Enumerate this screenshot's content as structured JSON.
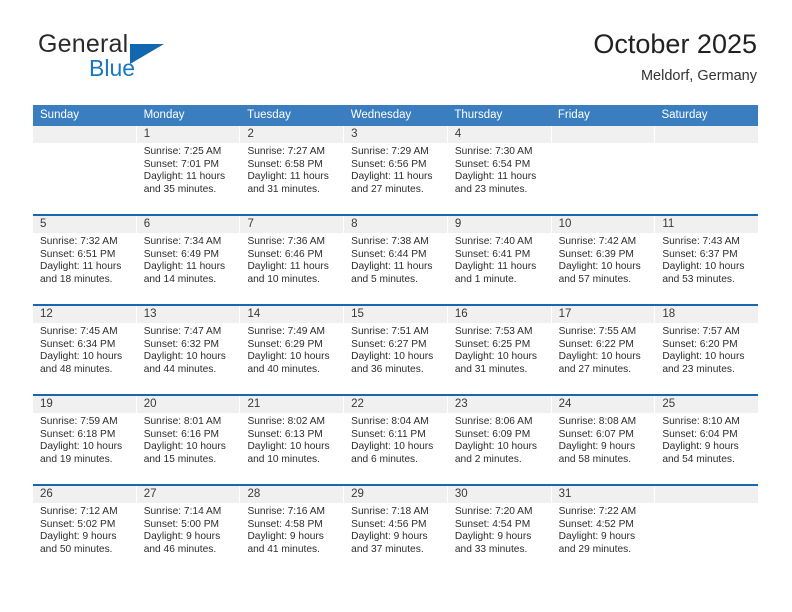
{
  "brand": {
    "word_general": "General",
    "word_blue": "Blue",
    "triangle_color": "#1167b0",
    "blue_color": "#1878c6"
  },
  "header": {
    "title": "October 2025",
    "location": "Meldorf, Germany"
  },
  "theme": {
    "header_bar": "#3a7ec0",
    "row_divider": "#1a67ad",
    "day_number_bg": "#f0f0f0"
  },
  "weekdays": [
    {
      "label": "Sunday"
    },
    {
      "label": "Monday"
    },
    {
      "label": "Tuesday"
    },
    {
      "label": "Wednesday"
    },
    {
      "label": "Thursday"
    },
    {
      "label": "Friday"
    },
    {
      "label": "Saturday"
    }
  ],
  "weeks": [
    {
      "days": [
        {
          "number": "",
          "sunrise": "",
          "sunset": "",
          "daylight": "",
          "empty": true
        },
        {
          "number": "1",
          "sunrise": "Sunrise: 7:25 AM",
          "sunset": "Sunset: 7:01 PM",
          "daylight": "Daylight: 11 hours and 35 minutes."
        },
        {
          "number": "2",
          "sunrise": "Sunrise: 7:27 AM",
          "sunset": "Sunset: 6:58 PM",
          "daylight": "Daylight: 11 hours and 31 minutes."
        },
        {
          "number": "3",
          "sunrise": "Sunrise: 7:29 AM",
          "sunset": "Sunset: 6:56 PM",
          "daylight": "Daylight: 11 hours and 27 minutes."
        },
        {
          "number": "4",
          "sunrise": "Sunrise: 7:30 AM",
          "sunset": "Sunset: 6:54 PM",
          "daylight": "Daylight: 11 hours and 23 minutes."
        },
        {
          "number": "",
          "sunrise": "",
          "sunset": "",
          "daylight": "",
          "empty": true
        },
        {
          "number": "",
          "sunrise": "",
          "sunset": "",
          "daylight": "",
          "empty": true
        }
      ]
    },
    {
      "days": [
        {
          "number": "5",
          "sunrise": "Sunrise: 7:32 AM",
          "sunset": "Sunset: 6:51 PM",
          "daylight": "Daylight: 11 hours and 18 minutes."
        },
        {
          "number": "6",
          "sunrise": "Sunrise: 7:34 AM",
          "sunset": "Sunset: 6:49 PM",
          "daylight": "Daylight: 11 hours and 14 minutes."
        },
        {
          "number": "7",
          "sunrise": "Sunrise: 7:36 AM",
          "sunset": "Sunset: 6:46 PM",
          "daylight": "Daylight: 11 hours and 10 minutes."
        },
        {
          "number": "8",
          "sunrise": "Sunrise: 7:38 AM",
          "sunset": "Sunset: 6:44 PM",
          "daylight": "Daylight: 11 hours and 5 minutes."
        },
        {
          "number": "9",
          "sunrise": "Sunrise: 7:40 AM",
          "sunset": "Sunset: 6:41 PM",
          "daylight": "Daylight: 11 hours and 1 minute."
        },
        {
          "number": "10",
          "sunrise": "Sunrise: 7:42 AM",
          "sunset": "Sunset: 6:39 PM",
          "daylight": "Daylight: 10 hours and 57 minutes."
        },
        {
          "number": "11",
          "sunrise": "Sunrise: 7:43 AM",
          "sunset": "Sunset: 6:37 PM",
          "daylight": "Daylight: 10 hours and 53 minutes."
        }
      ]
    },
    {
      "days": [
        {
          "number": "12",
          "sunrise": "Sunrise: 7:45 AM",
          "sunset": "Sunset: 6:34 PM",
          "daylight": "Daylight: 10 hours and 48 minutes."
        },
        {
          "number": "13",
          "sunrise": "Sunrise: 7:47 AM",
          "sunset": "Sunset: 6:32 PM",
          "daylight": "Daylight: 10 hours and 44 minutes."
        },
        {
          "number": "14",
          "sunrise": "Sunrise: 7:49 AM",
          "sunset": "Sunset: 6:29 PM",
          "daylight": "Daylight: 10 hours and 40 minutes."
        },
        {
          "number": "15",
          "sunrise": "Sunrise: 7:51 AM",
          "sunset": "Sunset: 6:27 PM",
          "daylight": "Daylight: 10 hours and 36 minutes."
        },
        {
          "number": "16",
          "sunrise": "Sunrise: 7:53 AM",
          "sunset": "Sunset: 6:25 PM",
          "daylight": "Daylight: 10 hours and 31 minutes."
        },
        {
          "number": "17",
          "sunrise": "Sunrise: 7:55 AM",
          "sunset": "Sunset: 6:22 PM",
          "daylight": "Daylight: 10 hours and 27 minutes."
        },
        {
          "number": "18",
          "sunrise": "Sunrise: 7:57 AM",
          "sunset": "Sunset: 6:20 PM",
          "daylight": "Daylight: 10 hours and 23 minutes."
        }
      ]
    },
    {
      "days": [
        {
          "number": "19",
          "sunrise": "Sunrise: 7:59 AM",
          "sunset": "Sunset: 6:18 PM",
          "daylight": "Daylight: 10 hours and 19 minutes."
        },
        {
          "number": "20",
          "sunrise": "Sunrise: 8:01 AM",
          "sunset": "Sunset: 6:16 PM",
          "daylight": "Daylight: 10 hours and 15 minutes."
        },
        {
          "number": "21",
          "sunrise": "Sunrise: 8:02 AM",
          "sunset": "Sunset: 6:13 PM",
          "daylight": "Daylight: 10 hours and 10 minutes."
        },
        {
          "number": "22",
          "sunrise": "Sunrise: 8:04 AM",
          "sunset": "Sunset: 6:11 PM",
          "daylight": "Daylight: 10 hours and 6 minutes."
        },
        {
          "number": "23",
          "sunrise": "Sunrise: 8:06 AM",
          "sunset": "Sunset: 6:09 PM",
          "daylight": "Daylight: 10 hours and 2 minutes."
        },
        {
          "number": "24",
          "sunrise": "Sunrise: 8:08 AM",
          "sunset": "Sunset: 6:07 PM",
          "daylight": "Daylight: 9 hours and 58 minutes."
        },
        {
          "number": "25",
          "sunrise": "Sunrise: 8:10 AM",
          "sunset": "Sunset: 6:04 PM",
          "daylight": "Daylight: 9 hours and 54 minutes."
        }
      ]
    },
    {
      "days": [
        {
          "number": "26",
          "sunrise": "Sunrise: 7:12 AM",
          "sunset": "Sunset: 5:02 PM",
          "daylight": "Daylight: 9 hours and 50 minutes."
        },
        {
          "number": "27",
          "sunrise": "Sunrise: 7:14 AM",
          "sunset": "Sunset: 5:00 PM",
          "daylight": "Daylight: 9 hours and 46 minutes."
        },
        {
          "number": "28",
          "sunrise": "Sunrise: 7:16 AM",
          "sunset": "Sunset: 4:58 PM",
          "daylight": "Daylight: 9 hours and 41 minutes."
        },
        {
          "number": "29",
          "sunrise": "Sunrise: 7:18 AM",
          "sunset": "Sunset: 4:56 PM",
          "daylight": "Daylight: 9 hours and 37 minutes."
        },
        {
          "number": "30",
          "sunrise": "Sunrise: 7:20 AM",
          "sunset": "Sunset: 4:54 PM",
          "daylight": "Daylight: 9 hours and 33 minutes."
        },
        {
          "number": "31",
          "sunrise": "Sunrise: 7:22 AM",
          "sunset": "Sunset: 4:52 PM",
          "daylight": "Daylight: 9 hours and 29 minutes."
        },
        {
          "number": "",
          "sunrise": "",
          "sunset": "",
          "daylight": "",
          "empty": true
        }
      ]
    }
  ]
}
